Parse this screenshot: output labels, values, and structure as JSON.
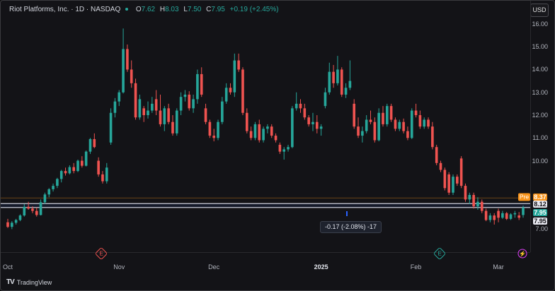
{
  "legend": {
    "symbol": "Riot Platforms, Inc. · 1D · NASDAQ",
    "open_key": "O",
    "open": "7.62",
    "high_key": "H",
    "high": "8.03",
    "low_key": "L",
    "low": "7.50",
    "close_key": "C",
    "close": "7.95",
    "change": "+0.19 (+2.45%)"
  },
  "currency": "USD",
  "price_tags": {
    "pre_label": "Pre",
    "pre": "8.37",
    "ref": "8.12",
    "last_green": "7.95",
    "last_white": "7.95"
  },
  "measure_label": "-0.17 (-2.08%) -17",
  "event_markers": [
    {
      "label": "E",
      "color": "#ef5350"
    },
    {
      "label": "E",
      "color": "#26a69a"
    },
    {
      "label": "⚡",
      "color": "#e040fb"
    }
  ],
  "footer": {
    "logo": "TV",
    "brand": "TradingView"
  },
  "colors": {
    "up": "#26a69a",
    "down": "#ef5350",
    "pre": "#f7931a",
    "bg": "#131317"
  },
  "chart_data": {
    "type": "candlestick",
    "title": "Riot Platforms, Inc. · 1D · NASDAQ",
    "y_ticks": [
      "7.00",
      "10.00",
      "11.00",
      "12.00",
      "13.00",
      "14.00",
      "15.00",
      "16.00"
    ],
    "x_ticks": [
      "Oct",
      "Nov",
      "Dec",
      "2025",
      "Feb",
      "Mar"
    ],
    "ylim": [
      6.3,
      16.4
    ],
    "horizontal_lines": [
      8.37,
      8.12,
      7.95
    ],
    "candles": [
      [
        7.3,
        7.45,
        7.05,
        7.1
      ],
      [
        7.1,
        7.35,
        7.0,
        7.28
      ],
      [
        7.28,
        7.45,
        7.2,
        7.4
      ],
      [
        7.4,
        7.65,
        7.35,
        7.6
      ],
      [
        7.6,
        8.1,
        7.55,
        7.98
      ],
      [
        7.98,
        8.2,
        7.85,
        7.9
      ],
      [
        7.9,
        8.0,
        7.7,
        7.8
      ],
      [
        7.8,
        7.95,
        7.55,
        7.62
      ],
      [
        7.62,
        8.3,
        7.6,
        8.18
      ],
      [
        8.18,
        8.6,
        8.1,
        8.52
      ],
      [
        8.52,
        8.8,
        8.4,
        8.75
      ],
      [
        8.75,
        9.0,
        8.65,
        8.9
      ],
      [
        8.9,
        9.25,
        8.8,
        9.2
      ],
      [
        9.2,
        9.6,
        9.05,
        9.55
      ],
      [
        9.55,
        9.7,
        9.35,
        9.45
      ],
      [
        9.45,
        9.8,
        9.4,
        9.72
      ],
      [
        9.72,
        9.9,
        9.45,
        9.55
      ],
      [
        9.55,
        10.05,
        9.5,
        10.0
      ],
      [
        10.0,
        10.2,
        9.7,
        9.78
      ],
      [
        9.78,
        10.45,
        9.75,
        10.4
      ],
      [
        10.4,
        11.0,
        10.3,
        10.95
      ],
      [
        10.95,
        11.2,
        10.55,
        10.6
      ],
      [
        10.0,
        10.15,
        9.3,
        9.4
      ],
      [
        9.4,
        9.55,
        9.0,
        9.1
      ],
      [
        9.1,
        9.9,
        9.0,
        9.7
      ],
      [
        10.8,
        12.3,
        10.7,
        12.1
      ],
      [
        12.1,
        12.75,
        11.9,
        12.6
      ],
      [
        12.6,
        13.1,
        12.4,
        13.0
      ],
      [
        13.0,
        15.8,
        12.95,
        14.9
      ],
      [
        14.9,
        15.1,
        13.9,
        14.0
      ],
      [
        14.0,
        14.4,
        13.2,
        13.4
      ],
      [
        13.4,
        13.6,
        11.8,
        11.9
      ],
      [
        11.9,
        12.9,
        11.8,
        12.7
      ],
      [
        12.3,
        12.4,
        11.7,
        12.0
      ],
      [
        12.0,
        12.6,
        11.85,
        12.2
      ],
      [
        12.2,
        12.8,
        12.1,
        12.5
      ],
      [
        12.7,
        13.1,
        12.0,
        12.2
      ],
      [
        12.2,
        12.9,
        11.5,
        11.6
      ],
      [
        11.6,
        12.4,
        11.3,
        12.3
      ],
      [
        12.3,
        12.5,
        11.6,
        11.7
      ],
      [
        11.7,
        12.0,
        11.1,
        11.2
      ],
      [
        11.2,
        12.3,
        11.1,
        12.2
      ],
      [
        12.2,
        13.0,
        12.0,
        12.8
      ],
      [
        12.8,
        13.1,
        12.6,
        12.9
      ],
      [
        12.9,
        13.05,
        12.2,
        12.3
      ],
      [
        12.3,
        12.9,
        12.1,
        12.7
      ],
      [
        12.7,
        14.0,
        12.5,
        13.8
      ],
      [
        13.8,
        14.1,
        12.8,
        12.9
      ],
      [
        12.3,
        12.5,
        11.6,
        11.7
      ],
      [
        11.7,
        11.8,
        11.0,
        11.1
      ],
      [
        11.1,
        11.4,
        10.85,
        11.0
      ],
      [
        11.0,
        11.8,
        10.9,
        11.7
      ],
      [
        11.7,
        12.8,
        11.6,
        12.6
      ],
      [
        12.6,
        13.4,
        12.5,
        13.2
      ],
      [
        13.2,
        13.4,
        12.9,
        13.0
      ],
      [
        13.0,
        14.7,
        12.8,
        14.4
      ],
      [
        14.4,
        14.7,
        13.9,
        14.0
      ],
      [
        14.0,
        14.1,
        12.0,
        12.1
      ],
      [
        12.1,
        12.3,
        11.2,
        11.3
      ],
      [
        11.3,
        11.5,
        10.9,
        11.0
      ],
      [
        11.0,
        11.7,
        10.9,
        11.6
      ],
      [
        11.6,
        11.8,
        10.8,
        10.9
      ],
      [
        10.9,
        11.5,
        10.8,
        11.4
      ],
      [
        11.4,
        11.6,
        11.2,
        11.5
      ],
      [
        11.5,
        11.6,
        11.0,
        11.1
      ],
      [
        11.1,
        11.2,
        10.8,
        10.9
      ],
      [
        10.7,
        10.8,
        10.3,
        10.4
      ],
      [
        10.4,
        10.6,
        10.05,
        10.5
      ],
      [
        10.5,
        10.7,
        10.4,
        10.6
      ],
      [
        10.6,
        12.4,
        10.55,
        12.3
      ],
      [
        12.3,
        13.0,
        12.2,
        12.5
      ],
      [
        12.5,
        12.7,
        12.1,
        12.3
      ],
      [
        12.3,
        12.5,
        11.8,
        11.9
      ],
      [
        11.9,
        12.0,
        11.5,
        11.6
      ],
      [
        11.6,
        12.1,
        11.3,
        11.7
      ],
      [
        11.7,
        12.0,
        11.2,
        11.4
      ],
      [
        11.4,
        11.6,
        11.1,
        11.5
      ],
      [
        12.4,
        13.2,
        12.3,
        13.0
      ],
      [
        13.0,
        14.3,
        12.9,
        13.9
      ],
      [
        13.9,
        14.2,
        13.2,
        13.4
      ],
      [
        13.4,
        14.6,
        13.3,
        14.0
      ],
      [
        14.0,
        14.1,
        12.8,
        12.9
      ],
      [
        12.9,
        13.4,
        12.75,
        13.2
      ],
      [
        13.2,
        14.4,
        13.1,
        13.5
      ],
      [
        12.5,
        12.7,
        11.4,
        11.5
      ],
      [
        11.5,
        11.9,
        11.0,
        11.1
      ],
      [
        11.1,
        11.5,
        10.8,
        11.3
      ],
      [
        11.3,
        12.0,
        11.2,
        11.8
      ],
      [
        11.8,
        12.2,
        11.6,
        11.7
      ],
      [
        11.7,
        11.9,
        10.8,
        10.9
      ],
      [
        10.9,
        12.3,
        10.85,
        12.1
      ],
      [
        12.1,
        12.4,
        11.5,
        11.6
      ],
      [
        11.6,
        12.5,
        11.5,
        12.4
      ],
      [
        12.4,
        12.5,
        11.7,
        11.8
      ],
      [
        11.8,
        11.9,
        11.3,
        11.4
      ],
      [
        11.4,
        11.8,
        11.3,
        11.7
      ],
      [
        11.7,
        11.85,
        11.2,
        11.3
      ],
      [
        11.3,
        11.5,
        10.9,
        11.0
      ],
      [
        11.0,
        12.3,
        10.95,
        12.2
      ],
      [
        12.2,
        12.5,
        11.9,
        12.0
      ],
      [
        12.0,
        12.2,
        11.4,
        11.5
      ],
      [
        11.5,
        11.9,
        11.4,
        11.8
      ],
      [
        11.8,
        11.9,
        11.4,
        11.5
      ],
      [
        11.5,
        11.7,
        10.5,
        10.6
      ],
      [
        10.6,
        10.7,
        9.8,
        9.9
      ],
      [
        9.9,
        10.0,
        9.5,
        9.6
      ],
      [
        9.6,
        9.7,
        8.7,
        8.8
      ],
      [
        9.4,
        9.5,
        8.5,
        8.6
      ],
      [
        8.6,
        9.4,
        8.5,
        9.3
      ],
      [
        9.3,
        9.4,
        8.9,
        9.0
      ],
      [
        10.1,
        10.2,
        8.8,
        8.9
      ],
      [
        8.9,
        9.0,
        8.2,
        8.3
      ],
      [
        8.3,
        8.6,
        8.1,
        8.5
      ],
      [
        8.5,
        8.6,
        7.9,
        8.0
      ],
      [
        8.0,
        8.4,
        7.85,
        8.2
      ],
      [
        8.2,
        8.3,
        7.7,
        7.8
      ],
      [
        7.8,
        7.9,
        7.35,
        7.4
      ],
      [
        7.4,
        7.7,
        7.3,
        7.6
      ],
      [
        7.6,
        7.7,
        7.2,
        7.4
      ],
      [
        7.8,
        7.9,
        7.3,
        7.5
      ],
      [
        7.5,
        7.8,
        7.45,
        7.7
      ],
      [
        7.7,
        7.75,
        7.4,
        7.45
      ],
      [
        7.45,
        7.7,
        7.4,
        7.65
      ],
      [
        7.65,
        7.8,
        7.5,
        7.7
      ],
      [
        7.6,
        7.75,
        7.4,
        7.5
      ],
      [
        7.62,
        8.03,
        7.5,
        7.95
      ]
    ]
  }
}
